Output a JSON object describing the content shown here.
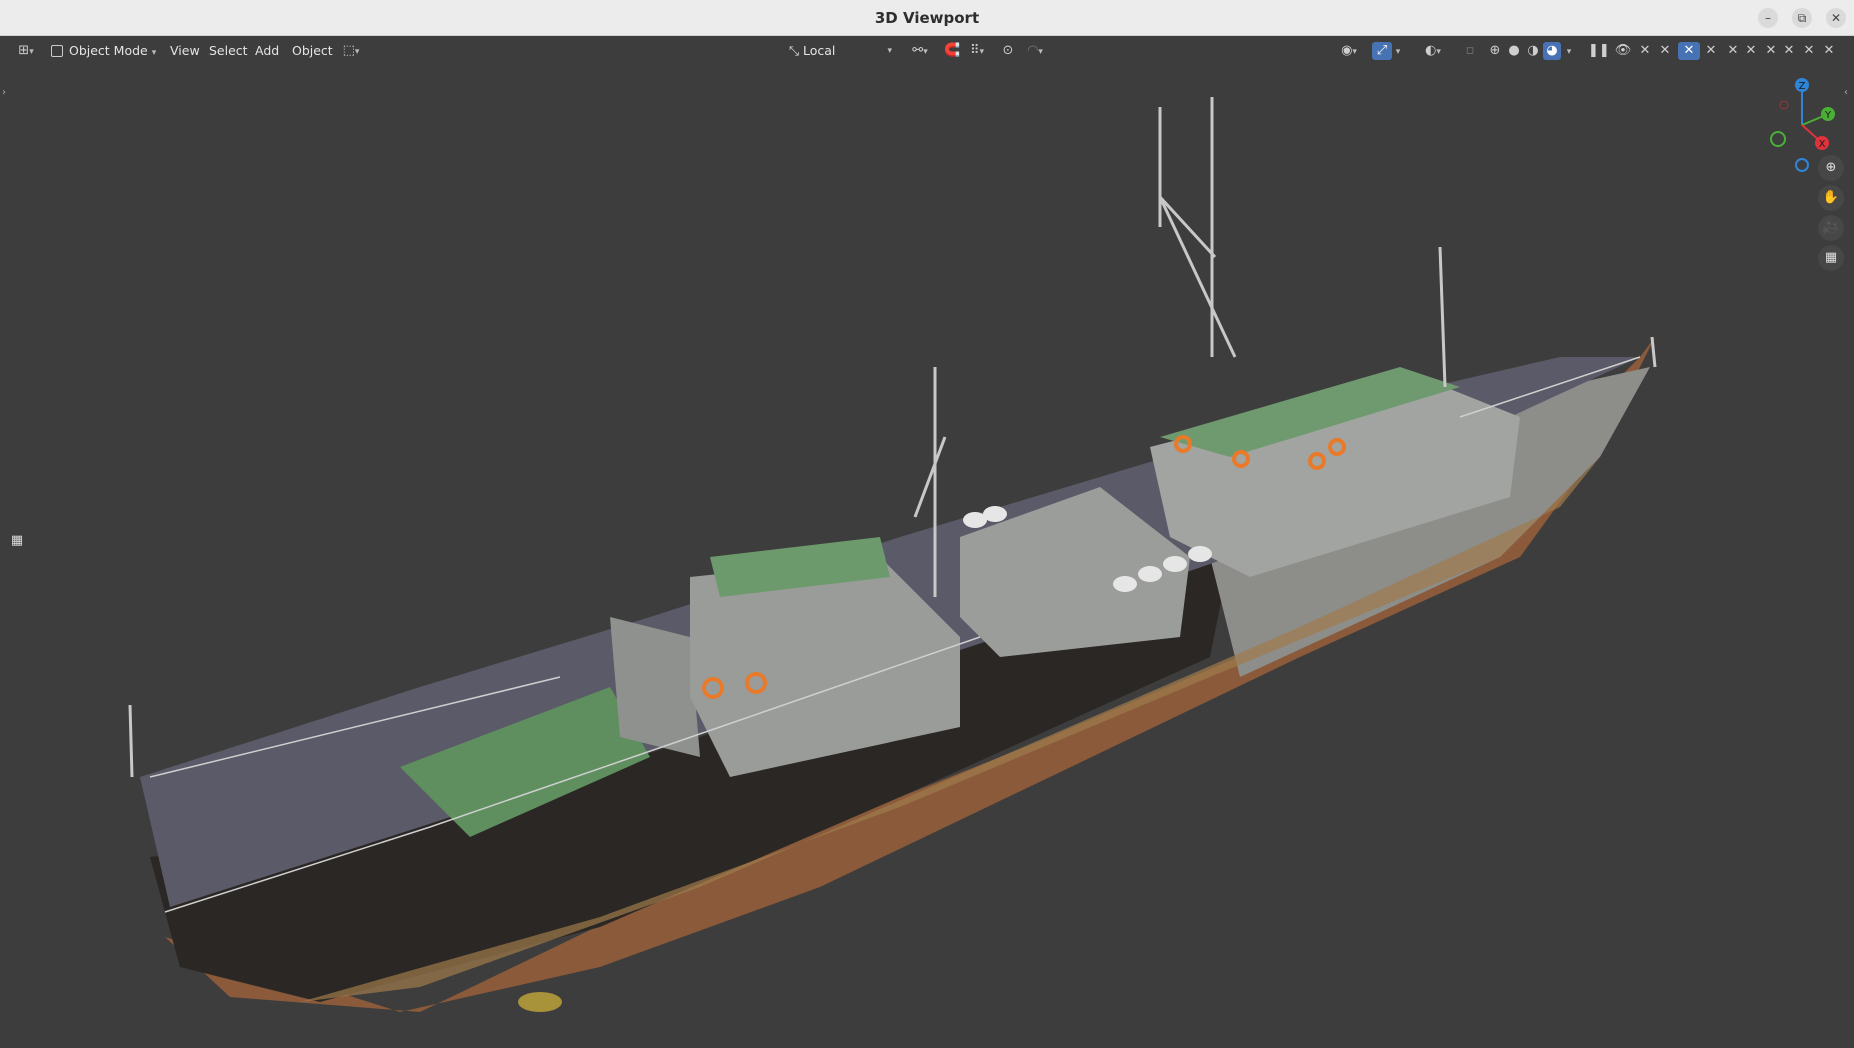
{
  "window": {
    "title": "3D Viewport",
    "controls": {
      "minimize": "–",
      "maximize": "⧉",
      "close": "✕"
    }
  },
  "header": {
    "editor_type_icon": "editor-type-icon",
    "mode": {
      "icon": "object-mode-icon",
      "label": "Object Mode"
    },
    "menus": [
      "View",
      "Select",
      "Add",
      "Object"
    ],
    "orientation": {
      "icon": "transform-orientation-icon",
      "label": "Local"
    }
  },
  "navigation": {
    "axes": {
      "z": "Z",
      "y": "Y",
      "x": "X"
    },
    "colors": {
      "x": "#e0323c",
      "y": "#4ab035",
      "z": "#2f86d8"
    }
  },
  "colors": {
    "accent": "#4772b3",
    "viewport_bg": "#3d3d3d"
  }
}
